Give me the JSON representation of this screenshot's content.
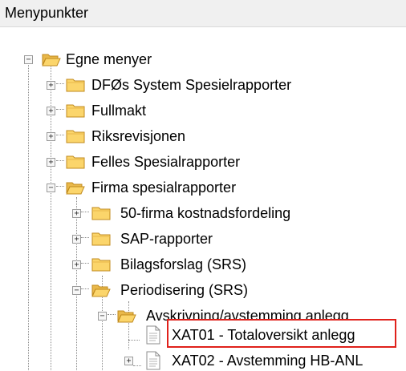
{
  "panel": {
    "title": "Menypunkter"
  },
  "tree": {
    "root": {
      "label": "Egne menyer",
      "expanded": true
    },
    "items": [
      {
        "label": "DFØs System Spesielrapporter",
        "expanded": false
      },
      {
        "label": "Fullmakt",
        "expanded": false
      },
      {
        "label": "Riksrevisjonen",
        "expanded": false
      },
      {
        "label": "Felles Spesialrapporter",
        "expanded": false
      },
      {
        "label": "Firma spesialrapporter",
        "expanded": true,
        "children": [
          {
            "label": "50-firma kostnadsfordeling",
            "expanded": false
          },
          {
            "label": "SAP-rapporter",
            "expanded": false
          },
          {
            "label": "Bilagsforslag (SRS)",
            "expanded": false
          },
          {
            "label": "Periodisering (SRS)",
            "expanded": true,
            "children": [
              {
                "label": "Avskrivning/avstemming anlegg",
                "expanded": true,
                "children": [
                  {
                    "label": "XAT01 - Totaloversikt anlegg",
                    "highlighted": true
                  },
                  {
                    "label": "XAT02 - Avstemming HB-ANL"
                  }
                ]
              }
            ]
          }
        ]
      }
    ]
  },
  "colors": {
    "highlight_border": "#e0211b",
    "folder_fill": "#fbd56b"
  }
}
